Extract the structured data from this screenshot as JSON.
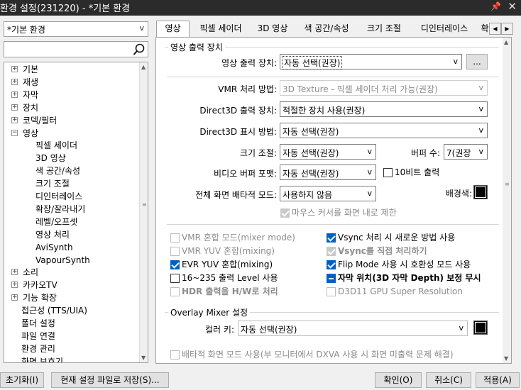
{
  "window": {
    "title": "환경 설정(231220) - *기본 환경",
    "pin_icon": "pin-icon",
    "close_icon": "close-icon"
  },
  "profile": {
    "value": "*기본 환경",
    "arrow": "v"
  },
  "search": {
    "value": "",
    "icon": "search-icon"
  },
  "tree": {
    "items": [
      {
        "label": "기본",
        "exp": "+"
      },
      {
        "label": "재생",
        "exp": "+"
      },
      {
        "label": "자막",
        "exp": "+"
      },
      {
        "label": "장치",
        "exp": "+"
      },
      {
        "label": "코덱/필터",
        "exp": "+"
      },
      {
        "label": "영상",
        "exp": "−"
      },
      {
        "label": "픽셀 세이더"
      },
      {
        "label": "3D 영상"
      },
      {
        "label": "색 공간/속성"
      },
      {
        "label": "크기 조절"
      },
      {
        "label": "디인터레이스"
      },
      {
        "label": "확장/잘라내기"
      },
      {
        "label": "레벨/오프셋"
      },
      {
        "label": "영상 처리"
      },
      {
        "label": "AviSynth"
      },
      {
        "label": "VapourSynth"
      },
      {
        "label": "소리",
        "exp": "+"
      },
      {
        "label": "카카오TV",
        "exp": "+"
      },
      {
        "label": "기능 확장",
        "exp": "+"
      },
      {
        "label": "접근성 (TTS/UIA)"
      },
      {
        "label": "폴더 설정"
      },
      {
        "label": "파일 연결"
      },
      {
        "label": "환경 관리"
      },
      {
        "label": "화면 보호기"
      }
    ]
  },
  "tabs": [
    "영상",
    "픽셀 세이더",
    "3D 영상",
    "색 공간/속성",
    "크기 조절",
    "디인터레이스",
    "확"
  ],
  "tabnav": {
    "left": "◀",
    "right": "▶"
  },
  "output": {
    "group_title": "영상 출력 장치",
    "device_label": "영상 출력 장치:",
    "device_value": "자동 선택(권장)",
    "more_button": "...",
    "vmr_label": "VMR 처리 방법:",
    "vmr_value": "3D Texture - 픽셀 세이더 처리 가능(권장)",
    "d3d_out_label": "Direct3D 출력 장치:",
    "d3d_out_value": "적절한 장치 사용(권장)",
    "d3d_disp_label": "Direct3D 표시 방법:",
    "d3d_disp_value": "자동 선택(권장)",
    "resize_label": "크기 조절:",
    "resize_value": "자동 선택(권장)",
    "buffer_label": "버퍼 수:",
    "buffer_value": "7(권장",
    "vbuf_label": "비디오 버퍼 포맷:",
    "vbuf_value": "자동 선택(권장)",
    "tenbit_label": "10비트 출력",
    "fs_label": "전체 화면 배타적 모드:",
    "fs_value": "사용하지 않음",
    "bg_label": "배경색:",
    "cursor_label": "마우스 커서를 화면 내로 제한",
    "arrow": "v"
  },
  "options": {
    "vmr_mix": "VMR 혼합 모드(mixer mode)",
    "vmr_yuv": "VMR YUV 혼합(mixing)",
    "evr_yuv": "EVR YUV 혼합(mixing)",
    "level16": "16~235 출력 Level 사용",
    "hdr": "HDR 출력을 H/W로 처리",
    "vsync_new": "Vsync 처리 시 새로운 방법 사용",
    "vsync_direct": "Vsync를 직접 처리하기",
    "flip": "Flip Mode 사용 시 호환성 모드 사용",
    "subpos": "자막 위치(3D 자막 Depth) 보정 무시",
    "d3d11": "D3D11 GPU Super Resolution"
  },
  "overlay": {
    "group_title": "Overlay Mixer 설정",
    "color_key_label": "컬러 키:",
    "color_key_value": "자동 선택(권장)",
    "exclusive_label": "배타적 화면 모드 사용(부 모니터에서 DXVA 사용 시 화면 미출력 문제 해결)"
  },
  "buttons": {
    "reset": "초기화(I)",
    "save_file": "현재 설정 파일로 저장(S)...",
    "ok": "확인(O)",
    "cancel": "취소(C)",
    "apply": "적용(A)"
  },
  "colors": {
    "bg_color": "#000000",
    "color_key": "#100010",
    "accent": "#0060c0"
  }
}
